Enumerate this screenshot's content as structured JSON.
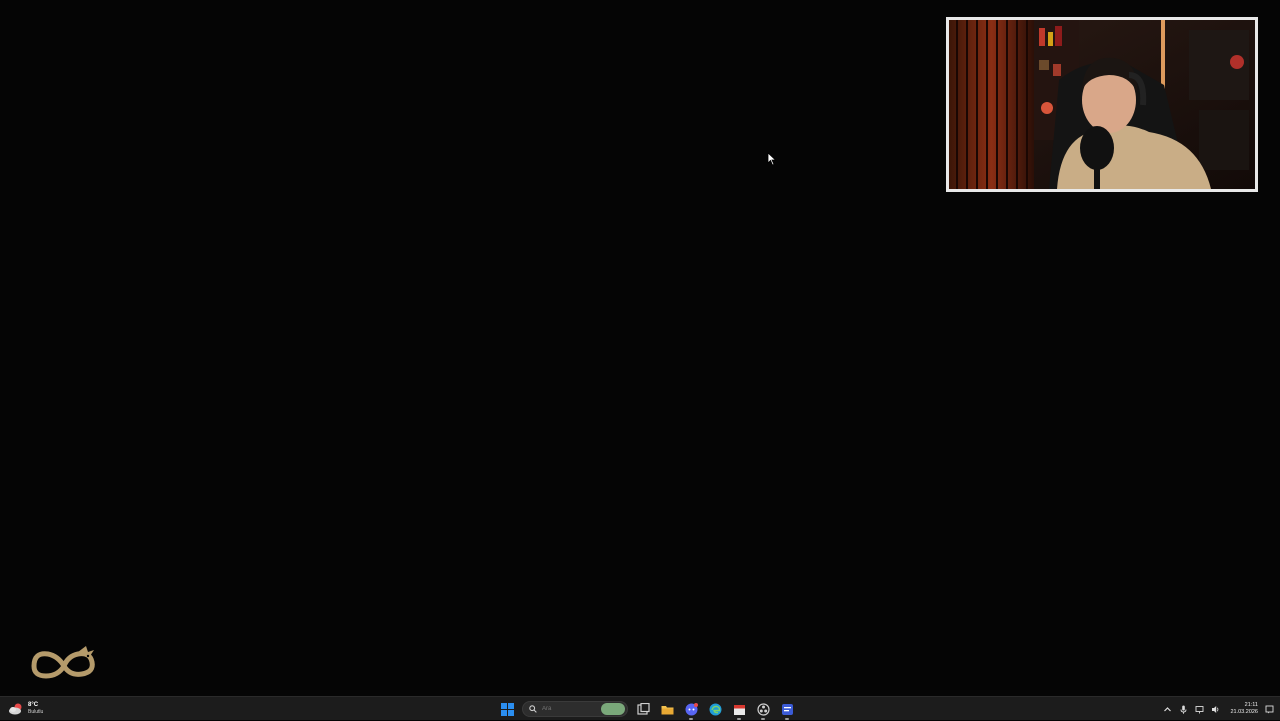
{
  "taskbar": {
    "weather": {
      "temp": "8°C",
      "condition": "Bulutlu",
      "icon": "cloudy-weather-icon"
    },
    "search": {
      "placeholder": "Ara"
    },
    "pinned_icons": [
      "windows-start-icon",
      "search-icon",
      "task-view-icon",
      "file-explorer-icon",
      "discord-icon",
      "edge-browser-icon",
      "calendar-app-icon",
      "obs-icon",
      "active-app-icon"
    ],
    "tray": {
      "icons": [
        "chevron-up-icon",
        "microphone-icon",
        "network-icon",
        "volume-icon"
      ],
      "time": "21:11",
      "date": "21.03.2026"
    }
  },
  "colors": {
    "desktop_bg": "#050505",
    "taskbar_bg": "#1c1c1c",
    "webcam_border": "#e9e9e9",
    "logo_gold": "#b59b6b",
    "windows_blue": "#2b8ef0"
  }
}
